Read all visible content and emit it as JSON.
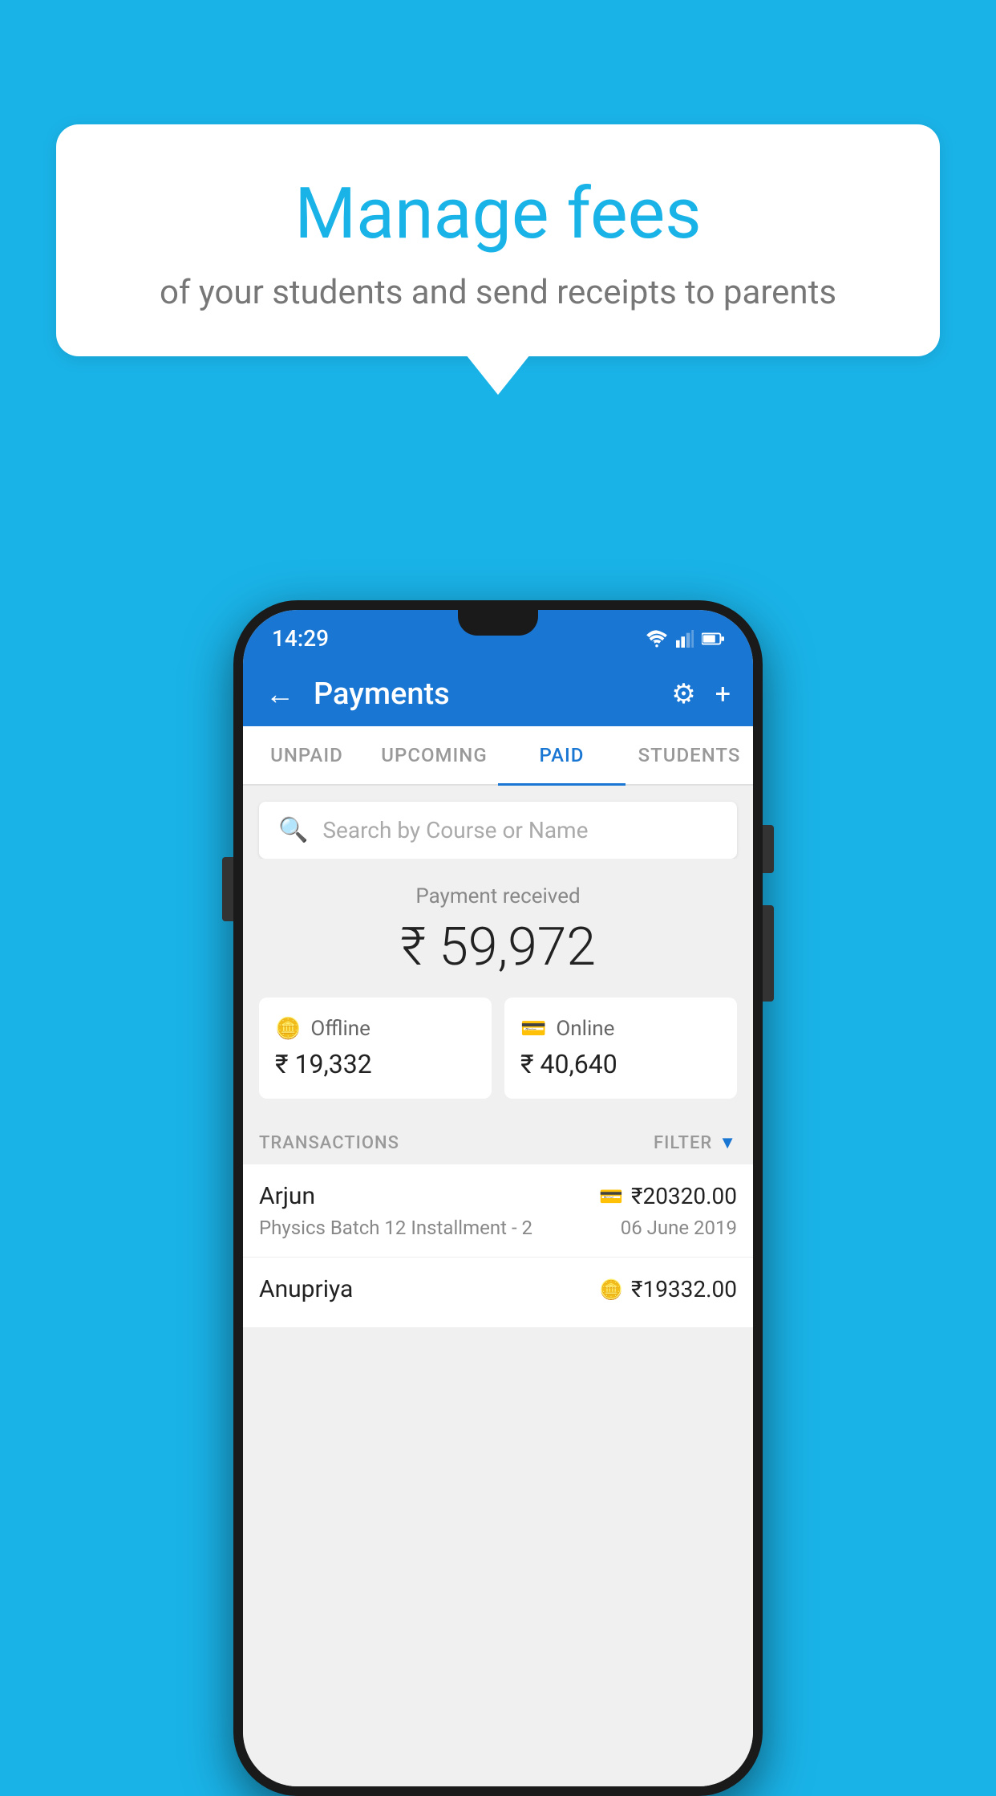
{
  "page": {
    "background_color": "#1ab3e8"
  },
  "speech_bubble": {
    "title": "Manage fees",
    "subtitle": "of your students and send receipts to parents"
  },
  "phone": {
    "status_bar": {
      "time": "14:29"
    },
    "header": {
      "title": "Payments",
      "back_label": "←",
      "settings_label": "⚙",
      "add_label": "+"
    },
    "tabs": [
      {
        "label": "UNPAID",
        "active": false
      },
      {
        "label": "UPCOMING",
        "active": false
      },
      {
        "label": "PAID",
        "active": true
      },
      {
        "label": "STUDENTS",
        "active": false
      }
    ],
    "search": {
      "placeholder": "Search by Course or Name"
    },
    "payment_summary": {
      "label": "Payment received",
      "amount": "₹ 59,972",
      "offline": {
        "icon": "offline-icon",
        "label": "Offline",
        "amount": "₹ 19,332"
      },
      "online": {
        "icon": "online-icon",
        "label": "Online",
        "amount": "₹ 40,640"
      }
    },
    "transactions": {
      "label": "TRANSACTIONS",
      "filter_label": "FILTER",
      "items": [
        {
          "name": "Arjun",
          "course": "Physics Batch 12 Installment - 2",
          "amount": "₹20320.00",
          "date": "06 June 2019",
          "payment_type": "card"
        },
        {
          "name": "Anupriya",
          "course": "",
          "amount": "₹19332.00",
          "date": "",
          "payment_type": "cash"
        }
      ]
    }
  }
}
